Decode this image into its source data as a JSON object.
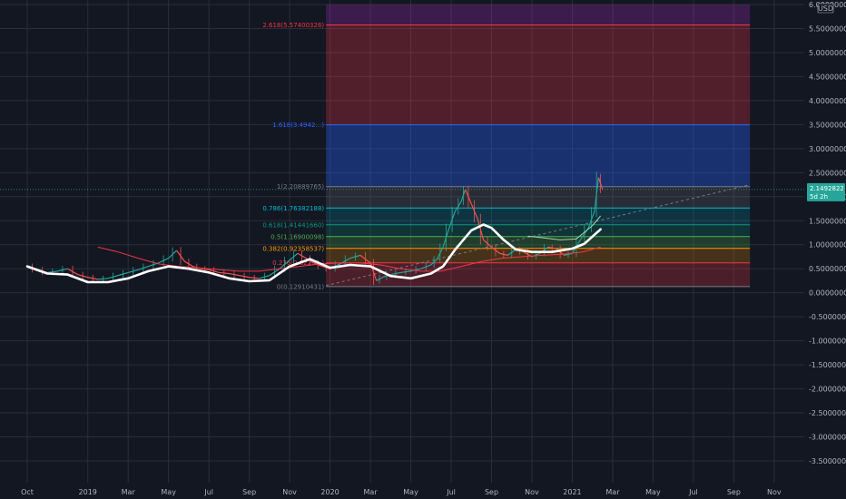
{
  "chart_data": {
    "type": "line",
    "ylim": [
      -3.75,
      6.0
    ],
    "currency_label": "USD",
    "last_price": "2.1492822",
    "countdown": "5d 2h",
    "y_ticks": [
      {
        "v": 6.0,
        "label": "6.00000000"
      },
      {
        "v": 5.5,
        "label": "5.50000000"
      },
      {
        "v": 5.0,
        "label": "5.00000000"
      },
      {
        "v": 4.5,
        "label": "4.50000000"
      },
      {
        "v": 4.0,
        "label": "4.00000000"
      },
      {
        "v": 3.5,
        "label": "3.50000000"
      },
      {
        "v": 3.0,
        "label": "3.00000000"
      },
      {
        "v": 2.5,
        "label": "2.50000000"
      },
      {
        "v": 2.0,
        "label": "2.00000000"
      },
      {
        "v": 1.5,
        "label": "1.50000000"
      },
      {
        "v": 1.0,
        "label": "1.00000000"
      },
      {
        "v": 0.5,
        "label": "0.50000000"
      },
      {
        "v": 0.0,
        "label": "0.00000000"
      },
      {
        "v": -0.5,
        "label": "-0.50000000"
      },
      {
        "v": -1.0,
        "label": "-1.00000000"
      },
      {
        "v": -1.5,
        "label": "-1.50000000"
      },
      {
        "v": -2.0,
        "label": "-2.00000000"
      },
      {
        "v": -2.5,
        "label": "-2.50000000"
      },
      {
        "v": -3.0,
        "label": "-3.00000000"
      },
      {
        "v": -3.5,
        "label": "-3.50000000"
      }
    ],
    "x_ticks": [
      {
        "t": 0,
        "label": "Oct"
      },
      {
        "t": 3,
        "label": "2019"
      },
      {
        "t": 5,
        "label": "Mar"
      },
      {
        "t": 7,
        "label": "May"
      },
      {
        "t": 9,
        "label": "Jul"
      },
      {
        "t": 11,
        "label": "Sep"
      },
      {
        "t": 13,
        "label": "Nov"
      },
      {
        "t": 15,
        "label": "2020"
      },
      {
        "t": 17,
        "label": "Mar"
      },
      {
        "t": 19,
        "label": "May"
      },
      {
        "t": 21,
        "label": "Jul"
      },
      {
        "t": 23,
        "label": "Sep"
      },
      {
        "t": 25,
        "label": "Nov"
      },
      {
        "t": 27,
        "label": "2021"
      },
      {
        "t": 29,
        "label": "Mar"
      },
      {
        "t": 31,
        "label": "May"
      },
      {
        "t": 33,
        "label": "Jul"
      },
      {
        "t": 35,
        "label": "Sep"
      },
      {
        "t": 37,
        "label": "Nov"
      }
    ],
    "fib": {
      "t_start": 14.8,
      "t_end": 35.8,
      "levels": [
        {
          "ratio": "0",
          "value": 0.12910431,
          "label": "0(0.12910431)",
          "color": "#787b86",
          "fill": "#f23645",
          "fill_opacity": 0.25
        },
        {
          "ratio": "0.236",
          "value": 0.6226,
          "label": "0.236(0.6226…)",
          "color": "#f23645",
          "fill": "#ff9800",
          "fill_opacity": 0.22
        },
        {
          "ratio": "0.382",
          "value": 0.92358537,
          "label": "0.382(0.92358537)",
          "color": "#ff9800",
          "fill": "#4caf50",
          "fill_opacity": 0.25
        },
        {
          "ratio": "0.5",
          "value": 1.16900098,
          "label": "0.5(1.16900098)",
          "color": "#4caf50",
          "fill": "#089981",
          "fill_opacity": 0.22
        },
        {
          "ratio": "0.618",
          "value": 1.4144166,
          "label": "0.618(1.41441660)",
          "color": "#089981",
          "fill": "#00bcd4",
          "fill_opacity": 0.18
        },
        {
          "ratio": "0.786",
          "value": 1.76382188,
          "label": "0.786(1.76382188)",
          "color": "#00bcd4",
          "fill": "#787b86",
          "fill_opacity": 0.22
        },
        {
          "ratio": "1",
          "value": 2.20889765,
          "label": "1(2.20889765)",
          "color": "#787b86",
          "fill": "#2962ff",
          "fill_opacity": 0.35
        },
        {
          "ratio": "1.618",
          "value": 3.4942,
          "label": "1.618(3.4942…)",
          "color": "#2962ff",
          "fill": "#f23645",
          "fill_opacity": 0.28
        },
        {
          "ratio": "2.618",
          "value": 5.57400326,
          "label": "2.618(5.57400326)",
          "color": "#f23645",
          "fill": "#9c27b0",
          "fill_opacity": 0.3
        }
      ]
    },
    "trendline": {
      "t1": 14.8,
      "v1": 0.15,
      "t2": 35.8,
      "v2": 2.25
    },
    "price_series": [
      [
        0,
        0.55
      ],
      [
        0.5,
        0.48
      ],
      [
        1,
        0.42
      ],
      [
        1.5,
        0.45
      ],
      [
        2,
        0.5
      ],
      [
        2.5,
        0.38
      ],
      [
        3,
        0.32
      ],
      [
        3.5,
        0.28
      ],
      [
        4,
        0.3
      ],
      [
        4.5,
        0.36
      ],
      [
        5,
        0.42
      ],
      [
        5.5,
        0.48
      ],
      [
        6,
        0.55
      ],
      [
        6.5,
        0.62
      ],
      [
        7,
        0.72
      ],
      [
        7.4,
        0.88
      ],
      [
        7.8,
        0.65
      ],
      [
        8.2,
        0.55
      ],
      [
        8.6,
        0.5
      ],
      [
        9,
        0.48
      ],
      [
        9.5,
        0.42
      ],
      [
        10,
        0.4
      ],
      [
        10.5,
        0.36
      ],
      [
        11,
        0.32
      ],
      [
        11.5,
        0.3
      ],
      [
        12,
        0.36
      ],
      [
        12.5,
        0.5
      ],
      [
        13,
        0.68
      ],
      [
        13.4,
        0.82
      ],
      [
        13.8,
        0.72
      ],
      [
        14.2,
        0.62
      ],
      [
        14.6,
        0.55
      ],
      [
        15,
        0.5
      ],
      [
        15.5,
        0.6
      ],
      [
        16,
        0.72
      ],
      [
        16.5,
        0.78
      ],
      [
        17,
        0.62
      ],
      [
        17.3,
        0.25
      ],
      [
        17.6,
        0.32
      ],
      [
        18,
        0.38
      ],
      [
        18.5,
        0.42
      ],
      [
        19,
        0.45
      ],
      [
        19.5,
        0.5
      ],
      [
        20,
        0.58
      ],
      [
        20.3,
        0.7
      ],
      [
        20.6,
        0.95
      ],
      [
        20.9,
        1.35
      ],
      [
        21.2,
        1.7
      ],
      [
        21.5,
        1.9
      ],
      [
        21.7,
        2.15
      ],
      [
        22,
        1.85
      ],
      [
        22.3,
        1.55
      ],
      [
        22.6,
        1.1
      ],
      [
        23,
        0.95
      ],
      [
        23.4,
        0.82
      ],
      [
        23.8,
        0.78
      ],
      [
        24.2,
        0.9
      ],
      [
        24.6,
        0.85
      ],
      [
        25,
        0.75
      ],
      [
        25.4,
        0.82
      ],
      [
        25.8,
        0.95
      ],
      [
        26.2,
        0.92
      ],
      [
        26.6,
        0.78
      ],
      [
        27,
        0.82
      ],
      [
        27.4,
        1.1
      ],
      [
        27.8,
        1.35
      ],
      [
        28.1,
        1.7
      ],
      [
        28.3,
        2.4
      ],
      [
        28.5,
        2.15
      ]
    ],
    "ma_white": [
      [
        0,
        0.55
      ],
      [
        1,
        0.4
      ],
      [
        2,
        0.38
      ],
      [
        3,
        0.22
      ],
      [
        4,
        0.22
      ],
      [
        5,
        0.3
      ],
      [
        6,
        0.45
      ],
      [
        7,
        0.55
      ],
      [
        8,
        0.5
      ],
      [
        9,
        0.42
      ],
      [
        10,
        0.3
      ],
      [
        11,
        0.24
      ],
      [
        12,
        0.26
      ],
      [
        13,
        0.55
      ],
      [
        14,
        0.7
      ],
      [
        15,
        0.52
      ],
      [
        16,
        0.58
      ],
      [
        17,
        0.55
      ],
      [
        18,
        0.35
      ],
      [
        19,
        0.3
      ],
      [
        20,
        0.4
      ],
      [
        20.6,
        0.55
      ],
      [
        21.2,
        0.9
      ],
      [
        22,
        1.3
      ],
      [
        22.6,
        1.42
      ],
      [
        23,
        1.35
      ],
      [
        23.6,
        1.1
      ],
      [
        24.2,
        0.9
      ],
      [
        25,
        0.85
      ],
      [
        26,
        0.85
      ],
      [
        27,
        0.92
      ],
      [
        27.6,
        1.02
      ],
      [
        28.4,
        1.32
      ]
    ],
    "ma_red": [
      [
        3.5,
        0.95
      ],
      [
        4.5,
        0.85
      ],
      [
        5.5,
        0.72
      ],
      [
        6.5,
        0.6
      ],
      [
        7.5,
        0.55
      ],
      [
        8.5,
        0.52
      ],
      [
        9.5,
        0.48
      ],
      [
        10.5,
        0.45
      ],
      [
        11.5,
        0.45
      ],
      [
        12.5,
        0.5
      ],
      [
        13.5,
        0.55
      ],
      [
        14.5,
        0.6
      ],
      [
        15.5,
        0.62
      ],
      [
        16.5,
        0.62
      ],
      [
        17.5,
        0.58
      ],
      [
        18.5,
        0.5
      ],
      [
        19.5,
        0.45
      ],
      [
        20.5,
        0.45
      ],
      [
        21.5,
        0.55
      ],
      [
        22.5,
        0.65
      ],
      [
        23.5,
        0.72
      ],
      [
        24.5,
        0.75
      ],
      [
        25.5,
        0.78
      ],
      [
        26.5,
        0.8
      ],
      [
        27.5,
        0.85
      ],
      [
        28.4,
        0.95
      ]
    ],
    "ma_green": [
      [
        24.8,
        1.18
      ],
      [
        25.6,
        1.14
      ],
      [
        26.4,
        1.1
      ],
      [
        27.2,
        1.12
      ],
      [
        28,
        1.4
      ],
      [
        28.4,
        1.6
      ]
    ]
  }
}
